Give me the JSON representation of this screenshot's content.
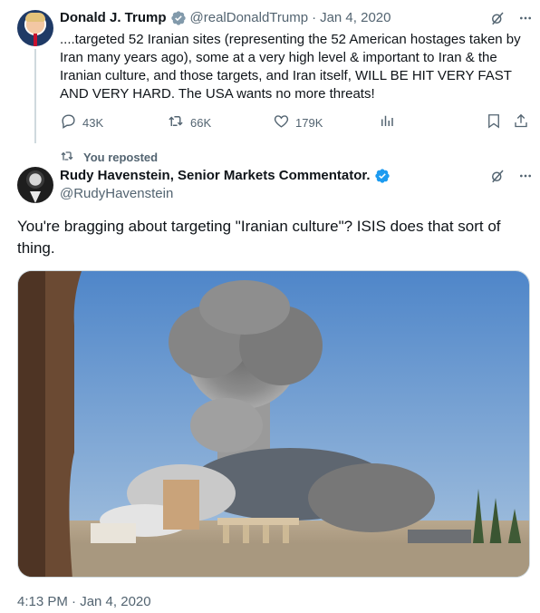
{
  "quoted_tweet": {
    "display_name": "Donald J. Trump",
    "handle": "@realDonaldTrump",
    "separator": "·",
    "date": "Jan 4, 2020",
    "text": "....targeted 52 Iranian sites (representing the 52 American hostages taken by Iran many years ago), some at a very high level & important to Iran &  the Iranian culture, and those targets, and Iran itself, WILL BE HIT VERY FAST AND VERY HARD. The USA wants no more threats!",
    "actions": {
      "replies": "43K",
      "reposts": "66K",
      "likes": "179K"
    }
  },
  "repost_label": "You reposted",
  "main_tweet": {
    "display_name": "Rudy Havenstein, Senior Markets Commentator.",
    "handle": "@RudyHavenstein",
    "text": "You're bragging about targeting \"Iranian culture\"? ISIS does that sort of thing.",
    "timestamp": "4:13 PM · Jan 4, 2020"
  },
  "icons": {
    "verified": "verified-badge-icon",
    "grok": "grok-icon",
    "more": "more-icon",
    "reply": "reply-icon",
    "repost": "repost-icon",
    "like": "like-icon",
    "views": "views-icon",
    "bookmark": "bookmark-icon",
    "share": "share-icon"
  },
  "colors": {
    "text": "#0f1419",
    "muted": "#536471",
    "verified_blue": "#1d9bf0",
    "verified_gray": "#829aab",
    "border": "#cfd9de"
  }
}
